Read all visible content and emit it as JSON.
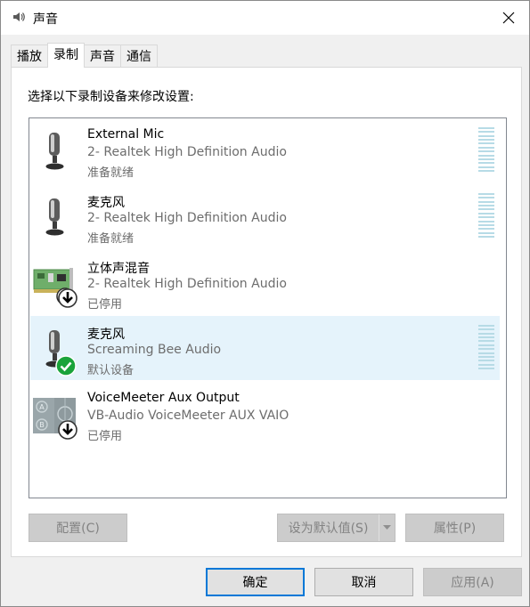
{
  "window": {
    "title": "声音",
    "icon": "speaker-icon"
  },
  "tabs": [
    {
      "label": "播放",
      "active": false
    },
    {
      "label": "录制",
      "active": true
    },
    {
      "label": "声音",
      "active": false
    },
    {
      "label": "通信",
      "active": false
    }
  ],
  "instruction": "选择以下录制设备来修改设置:",
  "devices": [
    {
      "name": "External Mic",
      "driver": "2- Realtek High Definition Audio",
      "status": "准备就绪",
      "icon": "microphone-icon",
      "badge": "",
      "meter": true,
      "selected": false
    },
    {
      "name": "麦克风",
      "driver": "2- Realtek High Definition Audio",
      "status": "准备就绪",
      "icon": "microphone-icon",
      "badge": "",
      "meter": true,
      "selected": false
    },
    {
      "name": "立体声混音",
      "driver": "2- Realtek High Definition Audio",
      "status": "已停用",
      "icon": "sound-card-icon",
      "badge": "disabled-arrow-icon",
      "meter": false,
      "selected": false
    },
    {
      "name": "麦克风",
      "driver": "Screaming Bee Audio",
      "status": "默认设备",
      "icon": "microphone-icon",
      "badge": "default-check-icon",
      "meter": true,
      "selected": true
    },
    {
      "name": "VoiceMeeter Aux Output",
      "driver": "VB-Audio VoiceMeeter AUX VAIO",
      "status": "已停用",
      "icon": "voicemeeter-icon",
      "badge": "disabled-arrow-icon",
      "meter": false,
      "selected": false
    }
  ],
  "buttons": {
    "configure": "配置(C)",
    "set_default": "设为默认值(S)",
    "properties": "属性(P)",
    "ok": "确定",
    "cancel": "取消",
    "apply": "应用(A)"
  },
  "colors": {
    "selected_row": "#e5f3fb",
    "meter": "#b7dbe6",
    "default_check": "#1aa33a",
    "focus_border": "#0078d7"
  }
}
